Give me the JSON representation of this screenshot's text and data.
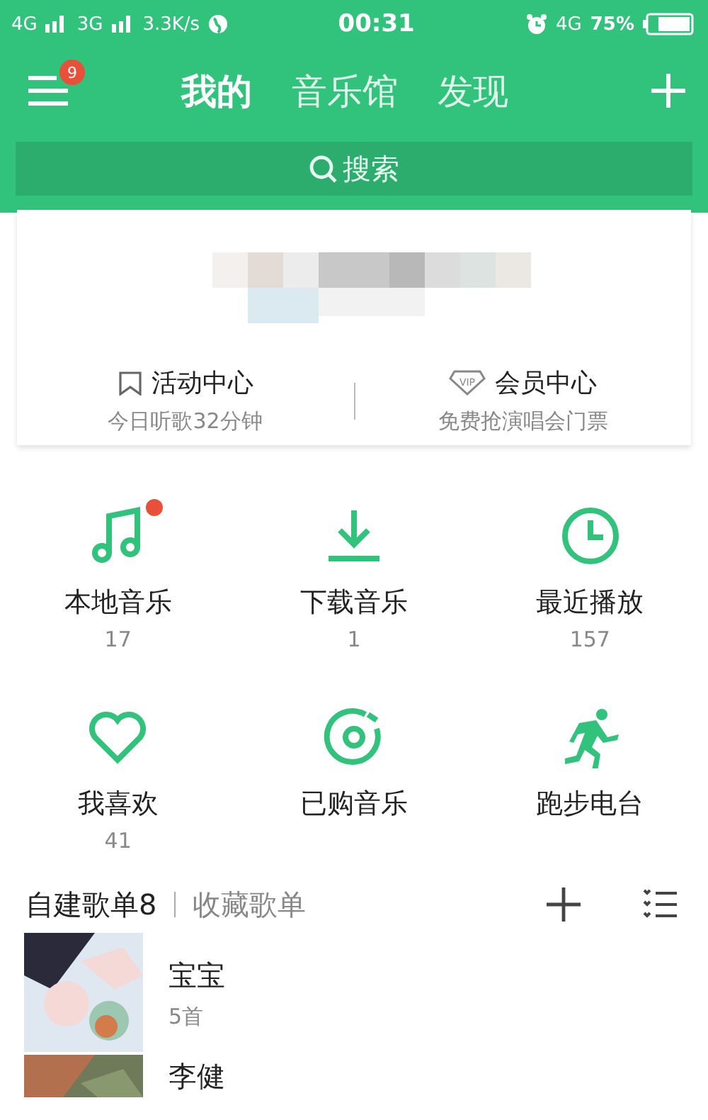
{
  "status_bar": {
    "network_1": "4G",
    "network_2": "3G",
    "speed": "3.3K/s",
    "time": "00:31",
    "network_3": "4G",
    "battery": "75%"
  },
  "header": {
    "badge": "9",
    "tabs": [
      {
        "label": "我的",
        "selected": true
      },
      {
        "label": "音乐馆",
        "selected": false
      },
      {
        "label": "发现",
        "selected": false
      }
    ]
  },
  "search": {
    "placeholder": "搜索"
  },
  "profile": {
    "links": [
      {
        "title": "活动中心",
        "subtitle": "今日听歌32分钟"
      },
      {
        "title": "会员中心",
        "subtitle": "免费抢演唱会门票",
        "icon_text": "VIP"
      }
    ]
  },
  "shortcuts": [
    {
      "label": "本地音乐",
      "count": "17",
      "dot": true
    },
    {
      "label": "下载音乐",
      "count": "1",
      "dot": false
    },
    {
      "label": "最近播放",
      "count": "157",
      "dot": false
    },
    {
      "label": "我喜欢",
      "count": "41",
      "dot": false
    },
    {
      "label": "已购音乐",
      "dot": false
    },
    {
      "label": "跑步电台",
      "dot": false
    }
  ],
  "playlist_tabs": [
    {
      "label": "自建歌单8",
      "selected": true
    },
    {
      "label": "收藏歌单",
      "selected": false
    }
  ],
  "playlists": [
    {
      "name": "宝宝",
      "count": "5首"
    },
    {
      "name": "李健"
    }
  ]
}
